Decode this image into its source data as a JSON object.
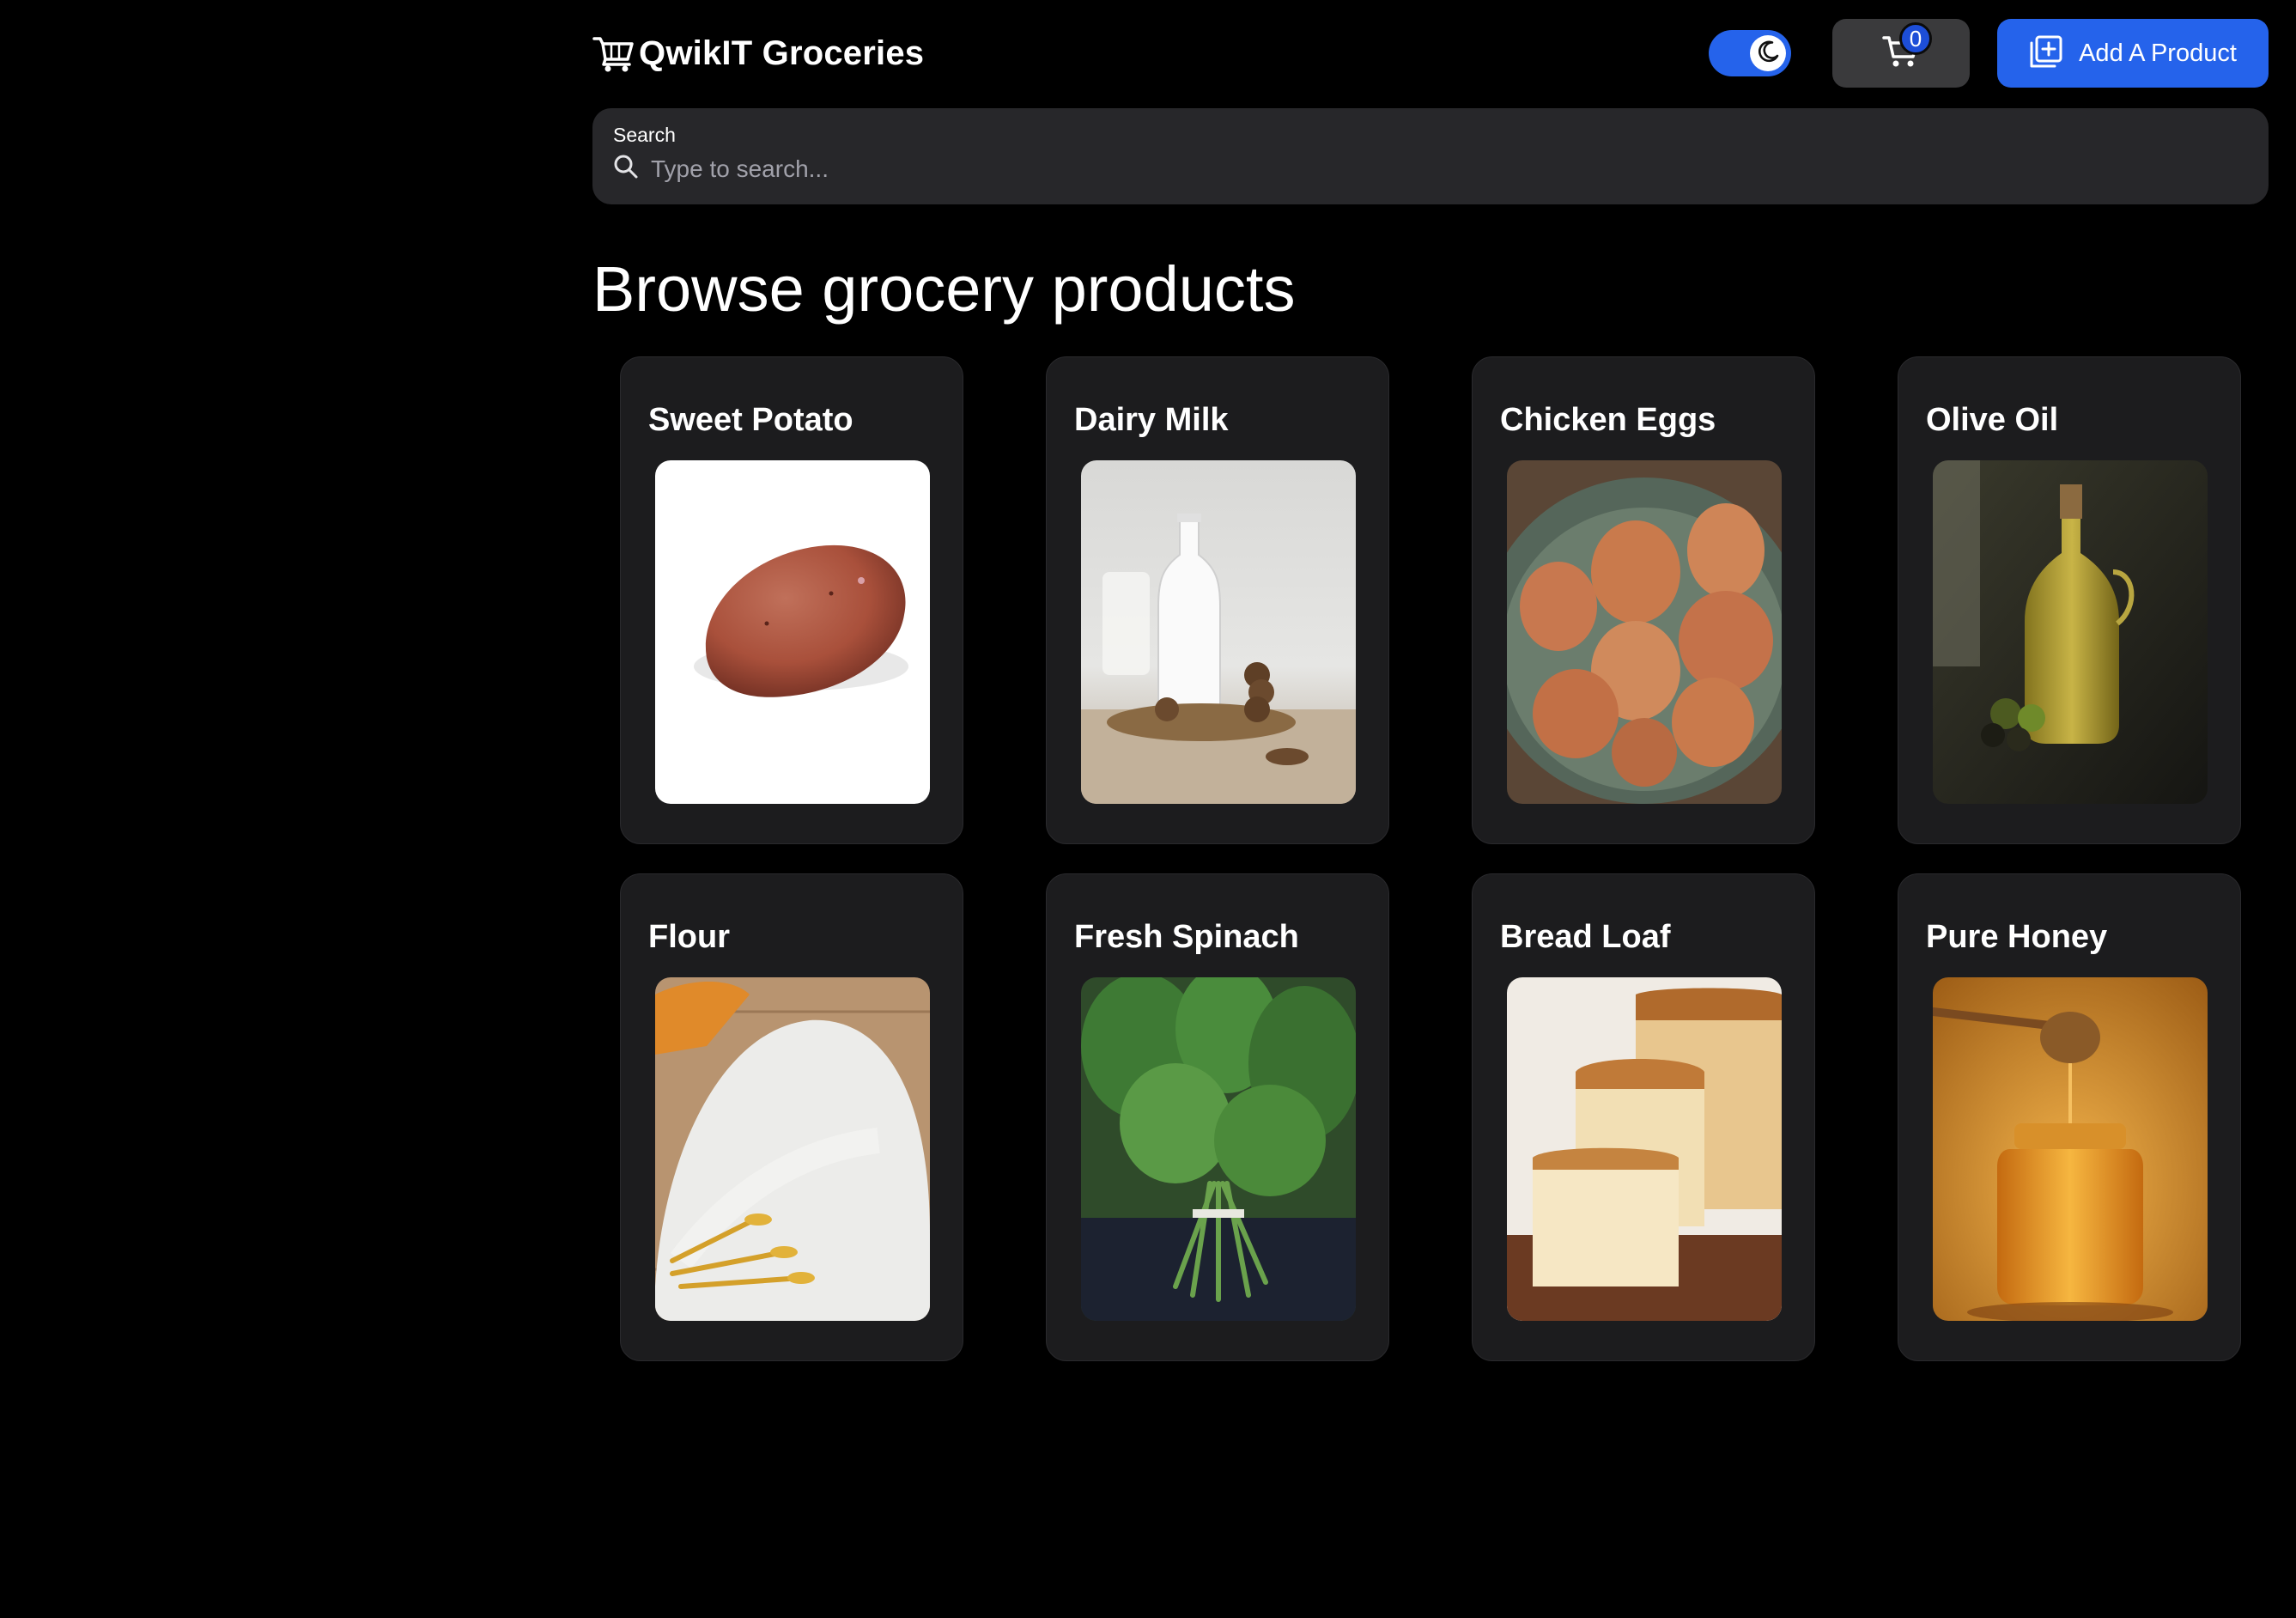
{
  "header": {
    "brand_icon": "shopping-cart-icon",
    "brand_title": "QwikIT Groceries",
    "theme_toggle_icon": "moon-icon",
    "cart_icon": "cart-icon",
    "cart_count": "0",
    "add_product_icon": "add-box-icon",
    "add_product_label": "Add A Product"
  },
  "search": {
    "label": "Search",
    "icon": "search-icon",
    "value": "",
    "placeholder": "Type to search..."
  },
  "main": {
    "title": "Browse grocery products"
  },
  "products": [
    {
      "name": "Sweet Potato"
    },
    {
      "name": "Dairy Milk"
    },
    {
      "name": "Chicken Eggs"
    },
    {
      "name": "Olive Oil"
    },
    {
      "name": "Flour"
    },
    {
      "name": "Fresh Spinach"
    },
    {
      "name": "Bread Loaf"
    },
    {
      "name": "Pure Honey"
    }
  ],
  "colors": {
    "background": "#000000",
    "accent": "#2563eb",
    "card": "#1c1c1e",
    "search": "#27272a"
  }
}
